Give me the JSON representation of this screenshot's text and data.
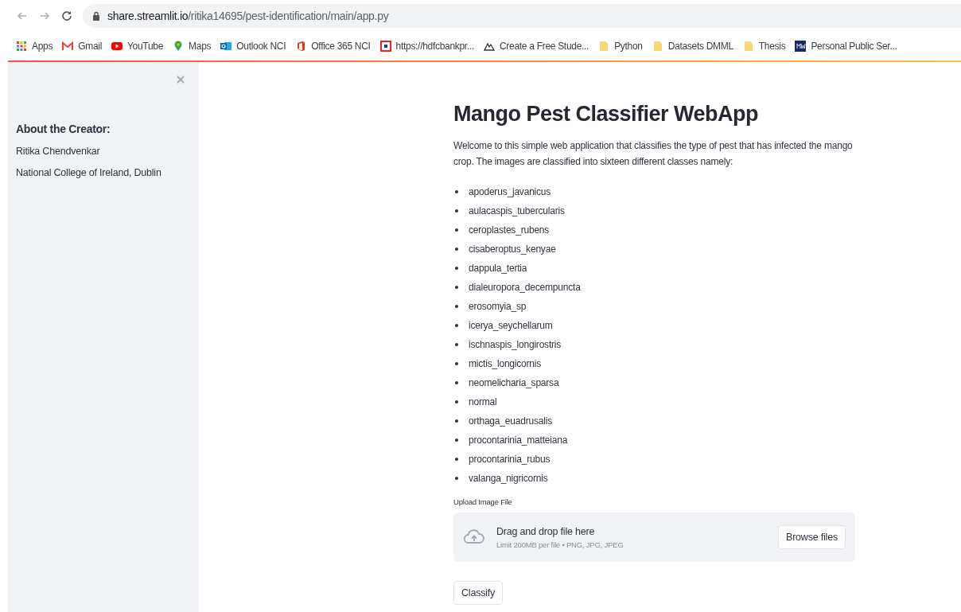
{
  "browser": {
    "url_host": "share.streamlit.io",
    "url_path": "/ritika14695/pest-identification/main/app.py",
    "bookmarks": [
      {
        "kind": "apps",
        "label": "Apps"
      },
      {
        "kind": "gmail",
        "label": "Gmail"
      },
      {
        "kind": "youtube",
        "label": "YouTube"
      },
      {
        "kind": "maps",
        "label": "Maps"
      },
      {
        "kind": "outlook",
        "label": "Outlook NCI"
      },
      {
        "kind": "office",
        "label": "Office 365 NCI"
      },
      {
        "kind": "bank",
        "label": "https://hdfcbankpr..."
      },
      {
        "kind": "peak",
        "label": "Create a Free Stude..."
      },
      {
        "kind": "folder",
        "label": "Python"
      },
      {
        "kind": "folder",
        "label": "Datasets DMML"
      },
      {
        "kind": "folder",
        "label": "Thesis"
      },
      {
        "kind": "mw",
        "label": "Personal Public Ser..."
      }
    ]
  },
  "sidebar": {
    "heading": "About the Creator:",
    "lines": [
      "Ritika Chendvenkar",
      "National College of Ireland, Dublin"
    ]
  },
  "main": {
    "title": "Mango Pest Classifier WebApp",
    "intro": "Welcome to this simple web application that classifies the type of pest that has infected the mango crop. The images are classified into sixteen different classes namely:",
    "classes": [
      "apoderus_javanicus",
      "aulacaspis_tubercularis",
      "ceroplastes_rubens",
      "cisaberoptus_kenyae",
      "dappula_tertia",
      "dialeuropora_decempuncta",
      "erosomyia_sp",
      "icerya_seychellarum",
      "ischnaspis_longirostris",
      "mictis_longicornis",
      "neomelicharia_sparsa",
      "normal",
      "orthaga_euadrusalis",
      "procontarinia_matteiana",
      "procontarinia_rubus",
      "valanga_nigricornis"
    ],
    "uploader": {
      "label": "Upload Image File",
      "drop_text": "Drag and drop file here",
      "limit_text": "Limit 200MB per file • PNG, JPG, JPEG",
      "browse_button": "Browse files"
    },
    "classify_button": "Classify"
  }
}
